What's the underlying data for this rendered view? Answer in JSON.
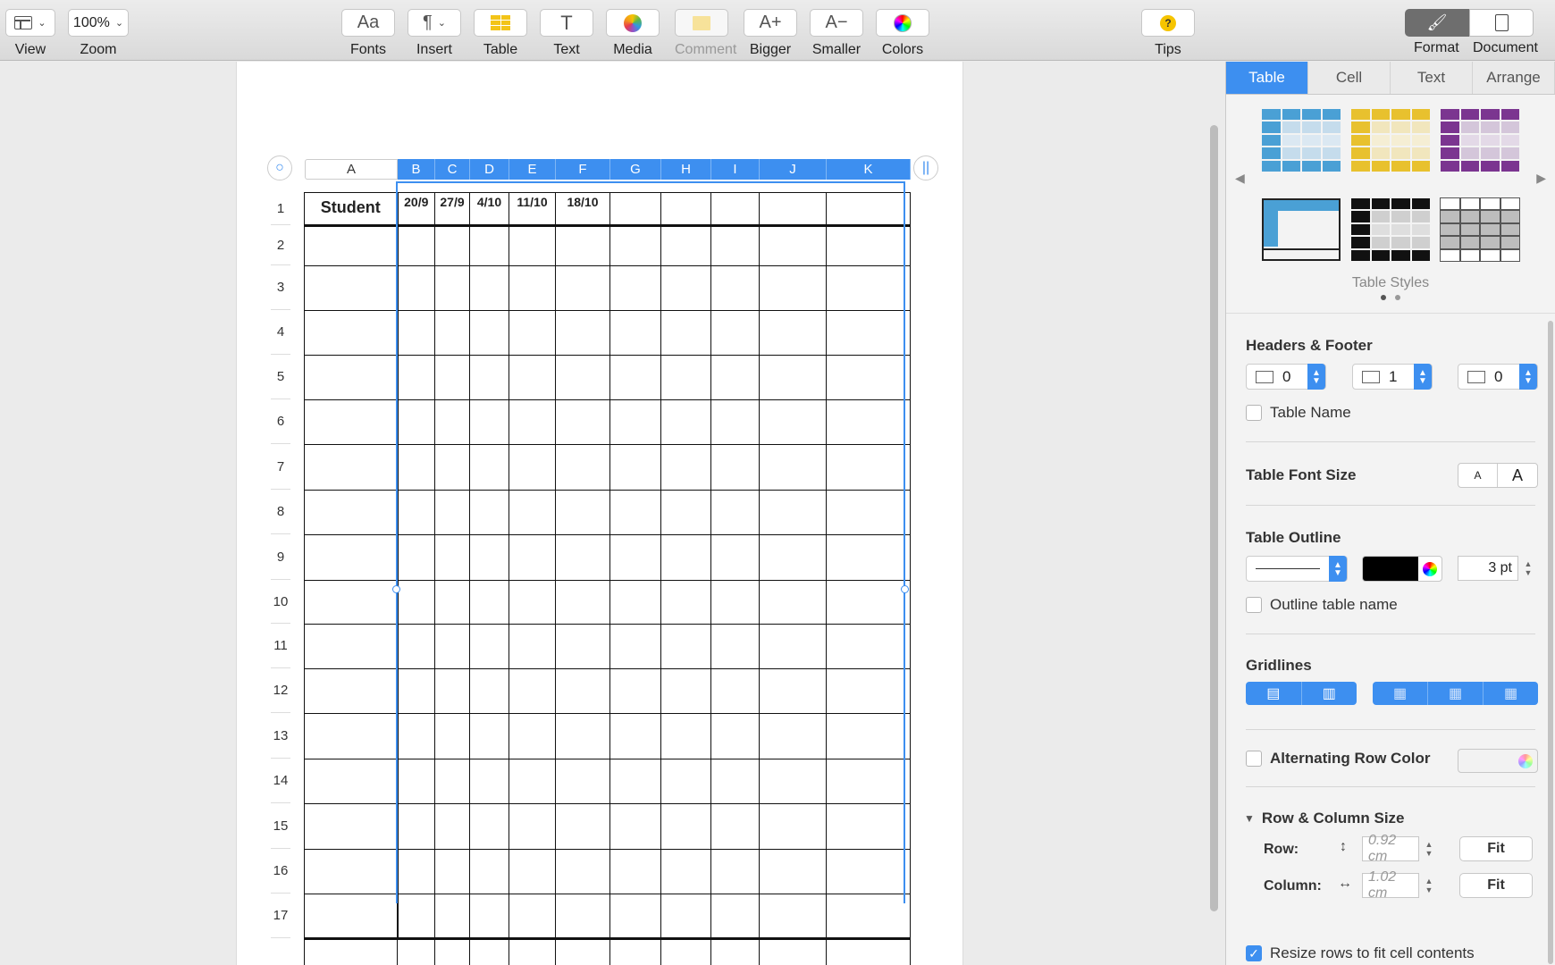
{
  "toolbar": {
    "view": "View",
    "zoom_value": "100%",
    "zoom": "Zoom",
    "fonts": "Fonts",
    "fonts_icon": "Aa",
    "insert": "Insert",
    "table": "Table",
    "text": "Text",
    "text_icon": "T",
    "media": "Media",
    "comment": "Comment",
    "bigger": "Bigger",
    "bigger_icon": "A+",
    "smaller": "Smaller",
    "smaller_icon": "A−",
    "colors": "Colors",
    "tips": "Tips",
    "format": "Format",
    "document": "Document"
  },
  "table": {
    "col_labels": [
      "A",
      "B",
      "C",
      "D",
      "E",
      "F",
      "G",
      "H",
      "I",
      "J",
      "K"
    ],
    "row_labels": [
      "1",
      "2",
      "3",
      "4",
      "5",
      "6",
      "7",
      "8",
      "9",
      "10",
      "11",
      "12",
      "13",
      "14",
      "15",
      "16",
      "17"
    ],
    "header_cells": [
      "Student",
      "20/9",
      "27/9",
      "4/10",
      "11/10",
      "18/10",
      "",
      "",
      "",
      "",
      ""
    ]
  },
  "sidebar": {
    "tabs": [
      "Table",
      "Cell",
      "Text",
      "Arrange"
    ],
    "active_tab": "Table",
    "table_styles_label": "Table Styles",
    "headers_footer": "Headers & Footer",
    "header_rows": "0",
    "header_cols": "1",
    "footer_rows": "0",
    "table_name": "Table Name",
    "table_font_size": "Table Font Size",
    "font_small": "A",
    "font_large": "A",
    "table_outline": "Table Outline",
    "outline_width": "3 pt",
    "outline_table_name": "Outline table name",
    "gridlines": "Gridlines",
    "alternating_row_color": "Alternating Row Color",
    "row_col_size": "Row & Column Size",
    "row_label": "Row:",
    "row_value": "0.92 cm",
    "column_label": "Column:",
    "column_value": "1.02 cm",
    "fit": "Fit",
    "resize_rows": "Resize rows to fit cell contents"
  },
  "colors": {
    "accent": "#3d8ff0",
    "style_blue": "#4aa0d5",
    "style_yellow": "#e8c12e",
    "style_purple": "#7b3590"
  }
}
